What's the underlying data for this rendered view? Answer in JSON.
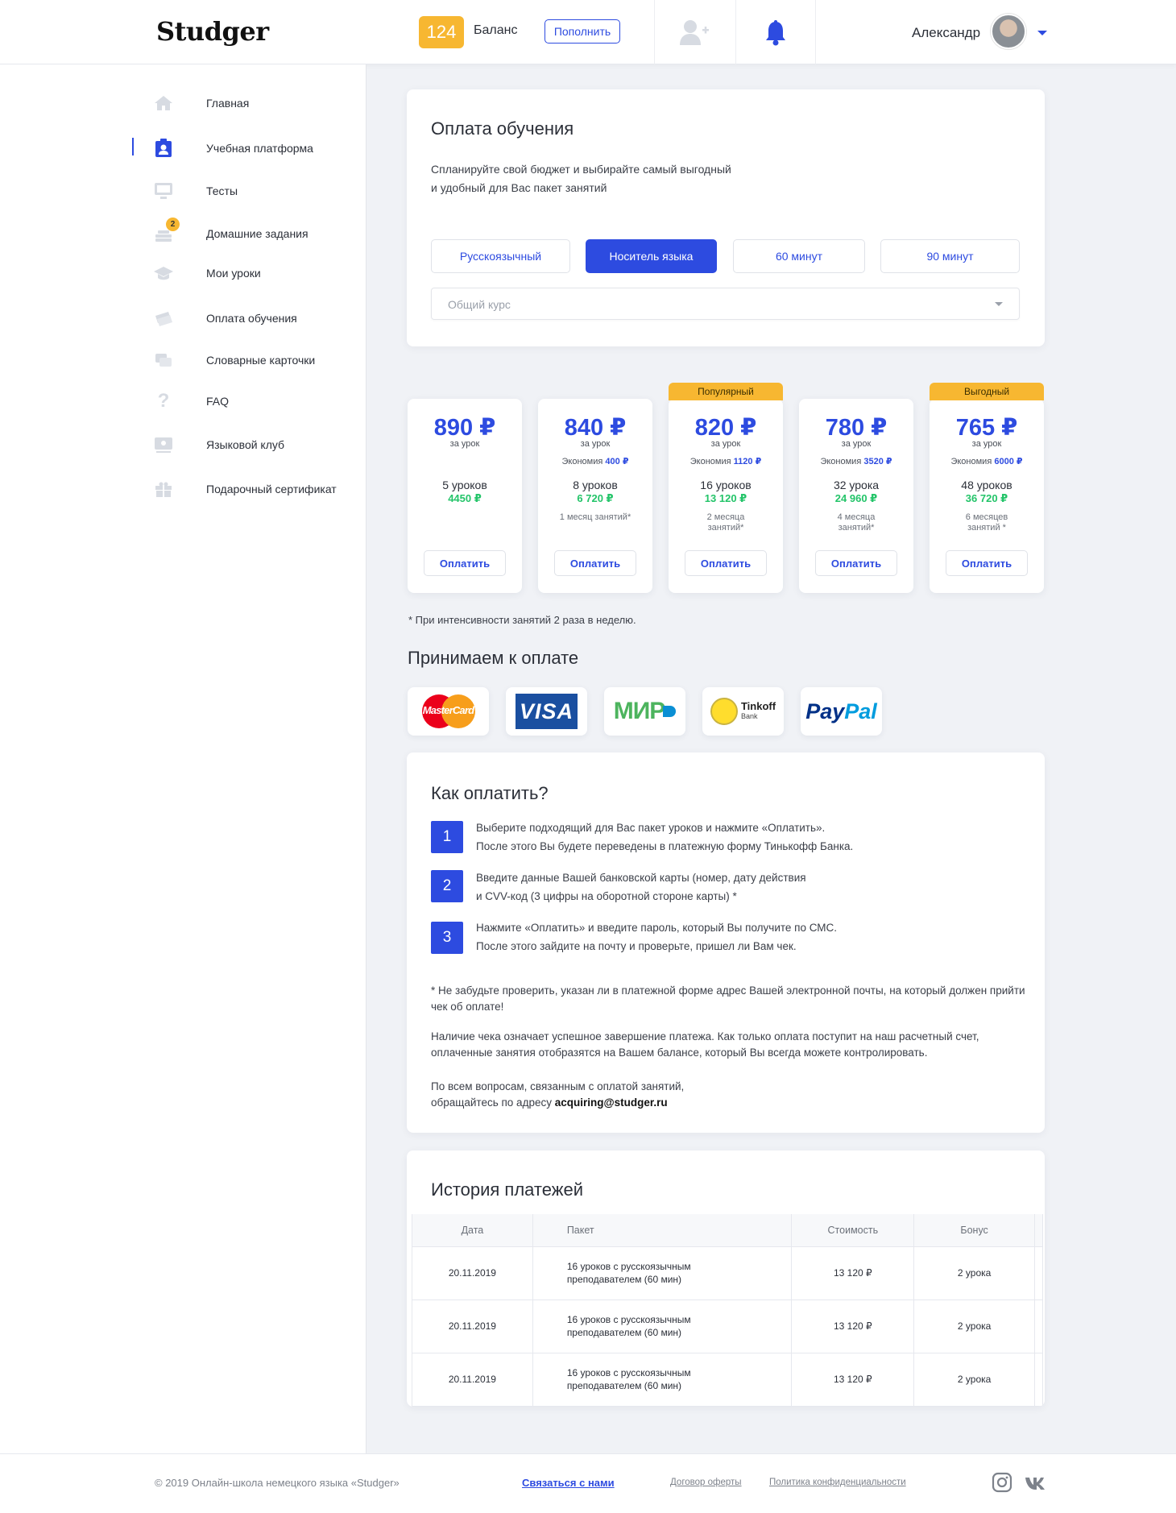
{
  "header": {
    "logo": "Studger",
    "balance_count": "124",
    "balance_label": "Баланс",
    "topup_label": "Пополнить",
    "user_name": "Александр"
  },
  "sidebar": {
    "items": [
      {
        "label": "Главная",
        "icon": "home-icon"
      },
      {
        "label": "Учебная платформа",
        "icon": "clipboard-user-icon",
        "active": true
      },
      {
        "label": "Тесты",
        "icon": "monitor-icon"
      },
      {
        "label": "Домашние задания",
        "icon": "homework-icon",
        "badge": "2"
      },
      {
        "label": "Мои уроки",
        "icon": "graduation-cap-icon"
      },
      {
        "label": "Оплата обучения",
        "icon": "money-icon"
      },
      {
        "label": "Словарные карточки",
        "icon": "cards-icon"
      },
      {
        "label": "FAQ",
        "icon": "question-icon"
      },
      {
        "label": "Языковой клуб",
        "icon": "club-icon"
      },
      {
        "label": "Подарочный сертификат",
        "icon": "gift-icon"
      }
    ]
  },
  "payment": {
    "title": "Оплата обучения",
    "subtitle_line1": "Спланируйте свой бюджет и выбирайте самый выгодный",
    "subtitle_line2": "и удобный для Вас пакет занятий",
    "filters": [
      "Русскоязычный",
      "Носитель языка",
      "60 минут",
      "90 минут"
    ],
    "active_filter": "Носитель языка",
    "course_placeholder": "Общий курс"
  },
  "packages": [
    {
      "price": "890 ₽",
      "per": "за урок",
      "saving_label": "",
      "saving_value": "",
      "lessons": "5 уроков",
      "total": "4450 ₽",
      "duration": "",
      "tag": "",
      "button": "Оплатить"
    },
    {
      "price": "840 ₽",
      "per": "за урок",
      "saving_label": "Экономия",
      "saving_value": "400 ₽",
      "lessons": "8 уроков",
      "total": "6 720 ₽",
      "duration": "1 месяц занятий*",
      "tag": "",
      "button": "Оплатить"
    },
    {
      "price": "820 ₽",
      "per": "за урок",
      "saving_label": "Экономия",
      "saving_value": "1120 ₽",
      "lessons": "16 уроков",
      "total": "13 120 ₽",
      "duration": "2 месяца занятий*",
      "tag": "Популярный",
      "button": "Оплатить"
    },
    {
      "price": "780 ₽",
      "per": "за урок",
      "saving_label": "Экономия",
      "saving_value": "3520 ₽",
      "lessons": "32 урока",
      "total": "24 960 ₽",
      "duration": "4 месяца занятий*",
      "tag": "",
      "button": "Оплатить"
    },
    {
      "price": "765 ₽",
      "per": "за урок",
      "saving_label": "Экономия",
      "saving_value": "6000 ₽",
      "lessons": "48 уроков",
      "total": "36 720 ₽",
      "duration": "6 месяцев занятий *",
      "tag": "Выгодный",
      "button": "Оплатить"
    }
  ],
  "footnote": "* При интенсивности занятий 2 раза в неделю.",
  "accept": {
    "title": "Принимаем к оплате",
    "methods": [
      {
        "name": "MasterCard",
        "icon": "mastercard-icon",
        "color": "#eb001b"
      },
      {
        "name": "VISA",
        "icon": "visa-icon",
        "color": "#1a1f71"
      },
      {
        "name": "МИР",
        "icon": "mir-icon",
        "color": "#4db45e"
      },
      {
        "name": "Tinkoff",
        "sub": "Bank",
        "icon": "tinkoff-icon",
        "color": "#ffdd2d"
      },
      {
        "name_a": "Pay",
        "name_b": "Pal",
        "icon": "paypal-icon",
        "color": "#003087"
      }
    ]
  },
  "howto": {
    "title": "Как оплатить?",
    "steps": [
      {
        "num": "1",
        "line1": "Выберите подходящий для Вас пакет уроков и нажмите «Оплатить».",
        "line2": "После этого Вы будете переведены в платежную форму Тинькофф Банка."
      },
      {
        "num": "2",
        "line1": "Введите данные Вашей банковской карты (номер, дату действия",
        "line2": "и CVV-код (3 цифры на оборотной стороне карты) *"
      },
      {
        "num": "3",
        "line1": "Нажмите «Оплатить» и введите пароль, который Вы получите по СМС.",
        "line2": "После этого зайдите на почту и проверьте, пришел ли Вам чек."
      }
    ],
    "note1": "* Не забудьте проверить, указан ли в платежной форме адрес Вашей электронной почты, на который должен прийти чек об оплате!",
    "note2": "Наличие чека означает успешное завершение платежа. Как только оплата поступит на наш расчетный счет, оплаченные занятия отобразятся на Вашем балансе, который Вы всегда можете контролировать.",
    "contact_line1": "По всем вопросам, связанным с оплатой занятий,",
    "contact_prefix": "обращайтесь по адресу",
    "email": "acquiring@studger.ru"
  },
  "history": {
    "title": "История платежей",
    "columns": [
      "Дата",
      "Пакет",
      "Стоимость",
      "Бонус"
    ],
    "rows": [
      {
        "date": "20.11.2019",
        "pkg1": "16 уроков с русскоязычным",
        "pkg2": "преподавателем (60 мин)",
        "cost": "13 120 ₽",
        "bonus": "2 урока"
      },
      {
        "date": "20.11.2019",
        "pkg1": "16 уроков с русскоязычным",
        "pkg2": "преподавателем (60 мин)",
        "cost": "13 120 ₽",
        "bonus": "2 урока"
      },
      {
        "date": "20.11.2019",
        "pkg1": "16 уроков с русскоязычным",
        "pkg2": "преподавателем (60 мин)",
        "cost": "13 120 ₽",
        "bonus": "2 урока"
      }
    ]
  },
  "footer": {
    "copyright": "© 2019 Онлайн-школа немецкого языка «Studger»",
    "contact": "Связаться с нами",
    "offer": "Договор оферты",
    "privacy": "Политика конфиденциальности"
  },
  "colors": {
    "accent": "#2d4be0",
    "warning": "#f7b731",
    "success": "#23c469"
  }
}
